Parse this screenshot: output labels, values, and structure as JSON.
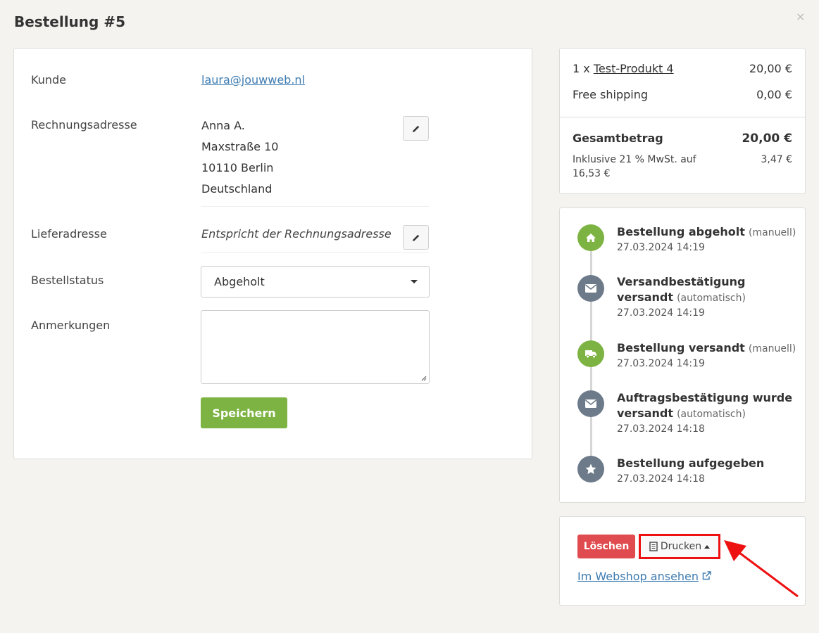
{
  "header": {
    "title": "Bestellung #5",
    "close_label": "×"
  },
  "form": {
    "customer_label": "Kunde",
    "customer_email": "laura@jouwweb.nl",
    "billing_label": "Rechnungsadresse",
    "billing_address": [
      "Anna A.",
      "Maxstraße 10",
      "10110 Berlin",
      "Deutschland"
    ],
    "shipping_label": "Lieferadresse",
    "shipping_value": "Entspricht der Rechnungsadresse",
    "status_label": "Bestellstatus",
    "status_value": "Abgeholt",
    "notes_label": "Anmerkungen",
    "notes_value": "",
    "save_label": "Speichern"
  },
  "summary": {
    "item_qty": "1 x",
    "item_name": "Test-Produkt 4",
    "item_price": "20,00 €",
    "shipping_label": "Free shipping",
    "shipping_price": "0,00 €",
    "total_label": "Gesamtbetrag",
    "total_value": "20,00 €",
    "tax_label": "Inklusive 21 % MwSt. auf 16,53 €",
    "tax_value": "3,47 €"
  },
  "timeline": [
    {
      "title": "Bestellung abgeholt",
      "note": "(manuell)",
      "date": "27.03.2024 14:19",
      "icon": "home-icon",
      "color": "#7cb342"
    },
    {
      "title": "Versandbestätigung versandt",
      "note": "(automatisch)",
      "date": "27.03.2024 14:19",
      "icon": "envelope-icon",
      "color": "#6c7a89"
    },
    {
      "title": "Bestellung versandt",
      "note": "(manuell)",
      "date": "27.03.2024 14:19",
      "icon": "truck-icon",
      "color": "#7cb342"
    },
    {
      "title": "Auftragsbestätigung wurde versandt",
      "note": "(automatisch)",
      "date": "27.03.2024 14:18",
      "icon": "envelope-icon",
      "color": "#6c7a89"
    },
    {
      "title": "Bestellung aufgegeben",
      "note": "",
      "date": "27.03.2024 14:18",
      "icon": "star-icon",
      "color": "#6c7a89"
    }
  ],
  "actions": {
    "delete_label": "Löschen",
    "print_label": "Drucken",
    "webshop_label": "Im Webshop ansehen"
  },
  "colors": {
    "accent_green": "#7cb342",
    "danger_red": "#e04b4f",
    "link_blue": "#3e7cb1",
    "highlight_red": "#ee1111"
  }
}
